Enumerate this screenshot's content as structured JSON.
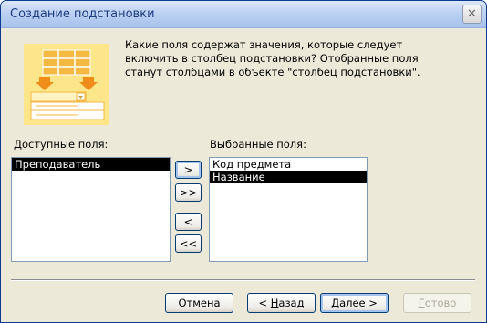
{
  "window": {
    "title": "Создание подстановки",
    "close_symbol": "✕"
  },
  "instruction": "Какие поля содержат значения, которые следует включить в столбец подстановки? Отобранные поля станут столбцами в объекте \"столбец подстановки\".",
  "available": {
    "label": "Доступные поля:",
    "items": [
      "Преподаватель"
    ]
  },
  "selected": {
    "label": "Выбранные поля:",
    "items": [
      "Код предмета",
      "Название"
    ]
  },
  "move_buttons": {
    "add_one": ">",
    "add_all": ">>",
    "remove_one": "<",
    "remove_all": "<<"
  },
  "footer": {
    "cancel": "Отмена",
    "back_prefix": "< ",
    "back_mnemonic": "Н",
    "back_rest": "азад",
    "next_mnemonic": "Д",
    "next_rest": "алее >",
    "finish_mnemonic": "Г",
    "finish_rest": "отово"
  },
  "colors": {
    "illustration_bg": "#fde68a",
    "illustration_accent": "#f4a623",
    "selection": "#000000"
  }
}
